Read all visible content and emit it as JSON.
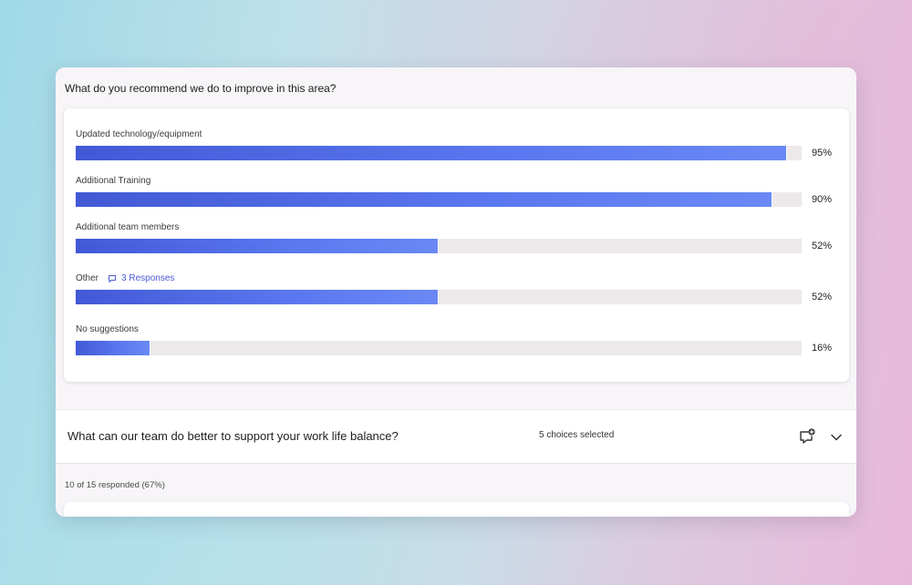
{
  "question1": {
    "title": "What do you recommend we do to improve in this area?",
    "options": [
      {
        "label": "Updated technology/equipment",
        "percent": 95,
        "percent_label": "95%",
        "fill": 0.98
      },
      {
        "label": "Additional Training",
        "percent": 90,
        "percent_label": "90%",
        "fill": 0.96
      },
      {
        "label": "Additional team members",
        "percent": 52,
        "percent_label": "52%",
        "fill": 0.5
      },
      {
        "label": "Other",
        "percent": 52,
        "percent_label": "52%",
        "fill": 0.5,
        "responses_link": "3 Responses"
      },
      {
        "label": "No suggestions",
        "percent": 16,
        "percent_label": "16%",
        "fill": 0.103
      }
    ]
  },
  "question2": {
    "title": "What can our team do better to support your work life balance?",
    "choices_selected": "5 choices selected",
    "icons": {
      "comment": "comment-add-icon",
      "expand": "chevron-down-icon"
    }
  },
  "responded": "10 of 15 responded (67%)",
  "colors": {
    "bar_fill": "#4f6be3",
    "bar_track": "#ede9ea",
    "link": "#4a5bd6"
  }
}
